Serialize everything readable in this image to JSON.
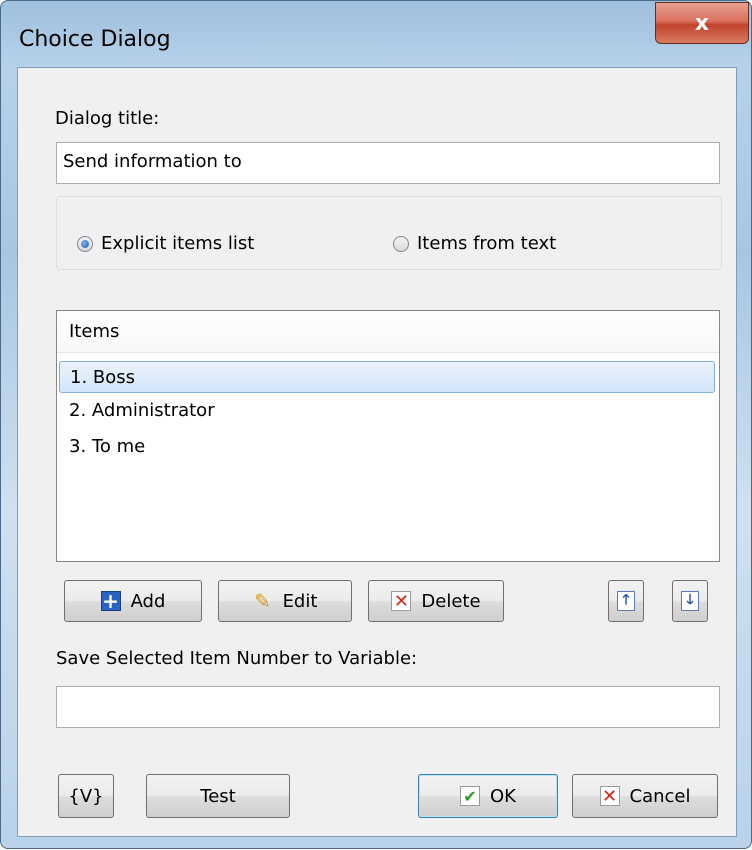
{
  "window": {
    "title": "Choice Dialog",
    "close_glyph": "x"
  },
  "dialog_title": {
    "label": "Dialog title:",
    "value": "Send information to"
  },
  "mode": {
    "options": [
      {
        "label": "Explicit items list",
        "checked": true
      },
      {
        "label": "Items from text",
        "checked": false
      }
    ]
  },
  "items": {
    "header": "Items",
    "rows": [
      "1. Boss",
      "2. Administrator",
      "3. To me"
    ],
    "selected_index": 0
  },
  "list_buttons": {
    "add": "Add",
    "edit": "Edit",
    "delete": "Delete",
    "up_icon": "arrow-up-icon",
    "down_icon": "arrow-down-icon"
  },
  "save_variable": {
    "label": "Save Selected Item Number to Variable:",
    "value": ""
  },
  "footer": {
    "variables": "{V}",
    "test": "Test",
    "ok": "OK",
    "cancel": "Cancel"
  },
  "colors": {
    "accent": "#3c7fb1",
    "selection": "#d3e6f9",
    "close": "#c2432b"
  }
}
